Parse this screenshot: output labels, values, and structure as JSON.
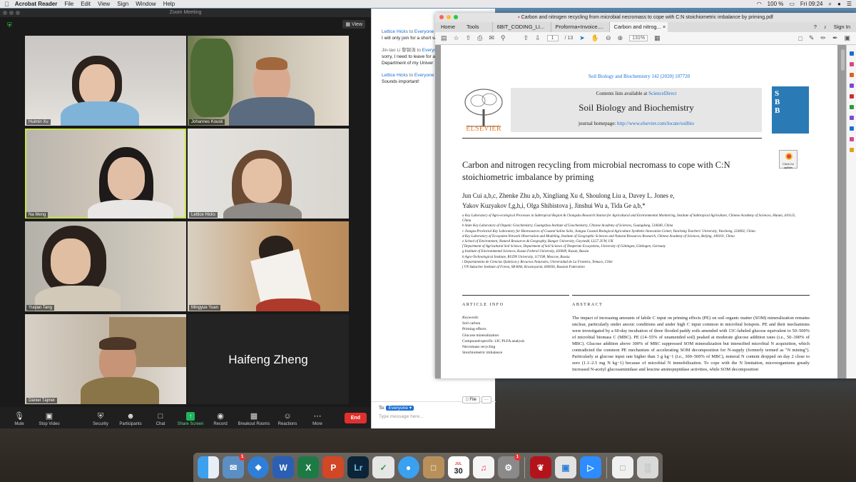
{
  "menubar": {
    "app": "Acrobat Reader",
    "menus": [
      "File",
      "Edit",
      "View",
      "Sign",
      "Window",
      "Help"
    ],
    "battery": "100 %",
    "clock": "Fri 09:24"
  },
  "zoom": {
    "window_title": "Zoom Meeting",
    "view_label": "View",
    "participants": [
      "Huimin Xu",
      "Johannes Kousk",
      "Na Meng",
      "Lettice Hicks",
      "Yuqian Tang",
      "Mingyue Yuan",
      "Dániel Tájmel",
      "Haifeng Zheng"
    ],
    "toolbar": {
      "mute": "Mute",
      "stop_video": "Stop Video",
      "security": "Security",
      "participants": "Participants",
      "chat": "Chat",
      "share": "Share Screen",
      "record": "Record",
      "breakout": "Breakout Rooms",
      "reactions": "Reactions",
      "more": "More",
      "end": "End"
    }
  },
  "chat": {
    "messages": [
      {
        "from": "Lettice Hicks",
        "to": "Everyone",
        "text": "I will only join for a short w"
      },
      {
        "from": "Jin-tao Li 黎锦涛",
        "to": "Everyo",
        "text": "sorry, I need to leave for a an emergency meeting wi Department of my Univer"
      },
      {
        "from": "Lettice Hicks",
        "to": "Everyone",
        "text": "Sounds important!"
      }
    ],
    "to_word": "to",
    "to_label": "To:",
    "to_value": "Everyone ▾",
    "placeholder": "Type message here...",
    "file_label": "File",
    "more_label": "···"
  },
  "acrobat": {
    "window_title": "Carbon and nitrogen recycling from microbial necromass to cope with C:N stoichiometric imbalance by priming.pdf",
    "nav": {
      "home": "Home",
      "tools": "Tools",
      "signin": "Sign In"
    },
    "tabs": [
      "6BIT_CODING_LI...",
      "Proforma+Invoice....",
      "Carbon and nitrog... ×"
    ],
    "page_current": "1",
    "page_total": "/ 13",
    "zoom": "131%",
    "paper": {
      "journal_ref": "Soil Biology and Biochemistry 142 (2020) 107720",
      "contents_prefix": "Contents lists available at",
      "contents_link": "ScienceDirect",
      "journal_name": "Soil Biology and Biochemistry",
      "homepage_prefix": "journal homepage:",
      "homepage_url": "http://www.elsevier.com/locate/soilbio",
      "publisher": "ELSEVIER",
      "badge": "Check for updates",
      "title": "Carbon and nitrogen recycling from microbial necromass to cope with C:N stoichiometric imbalance by priming",
      "authors_line1": "Jun Cui a,b,c, Zhenke Zhu a,b, Xingliang Xu d, Shoulong Liu a, Davey L. Jones e,",
      "authors_line2": "Yakov Kuzyakov f,g,h,i, Olga Shibistova j, Jinshui Wu a, Tida Ge a,b,*",
      "affiliations": [
        "a Key Laboratory of Agro-ecological Processes in Subtropical Region & Changsha Research Station for Agricultural and Environmental Monitoring, Institute of Subtropical Agriculture, Chinese Academy of Sciences, Hunan, 410125, China",
        "b State Key Laboratory of Organic Geochemistry, Guangzhou Institute of Geochemistry, Chinese Academy of Sciences, Guangdong, 510640, China",
        "c Jiangsu Provincial Key Laboratory for Bioresources of Coastal Saline Soils, Jiangsu Coastal Biological Agriculture Synthetic Innovation Center, Yancheng Teachers' University, Yancheng, 224002, China",
        "d Key Laboratory of Ecosystem Network Observation and Modeling, Institute of Geographic Sciences and Natural Resources Research, Chinese Academy of Sciences, Beijing, 100101, China",
        "e School of Environment, Natural Resources & Geography, Bangor University, Gwynedd, LL57 2UW, UK",
        "f Department of Agricultural Soil Science, Department of Soil Science of Temperate Ecosystems, University of Göttingen, Göttingen, Germany",
        "g Institute of Environmental Sciences, Kazan Federal University, 420049, Kazan, Russia",
        "h Agro-Technological Institute, RUDN University, 117198, Moscow, Russia",
        "i Departamento de Ciencias Químicas y Recursos Naturales, Universidad de La Frontera, Temuco, Chile",
        "j VN Sukachev Institute of Forest, SB-RAS, Krasnoyarsk, 660036, Russian Federation"
      ],
      "article_info_heading": "ARTICLE INFO",
      "keywords_label": "Keywords:",
      "keywords": [
        "Soil carbon",
        "Priming effects",
        "Glucose mineralization",
        "Compound-specific 13C PLFA analysis",
        "Necromass recycling",
        "Stoichiometric imbalance"
      ],
      "abstract_heading": "ABSTRACT",
      "abstract": "The impact of increasing amounts of labile C input on priming effects (PE) on soil organic matter (SOM) mineralization remains unclear, particularly under anoxic conditions and under high C input common in microbial hotspots. PE and their mechanisms were investigated by a 60-day incubation of three flooded paddy soils amended with 13C-labeled glucose equivalent to 50–500% of microbial biomass C (MBC). PE (14–55% of unamended soil) peaked at moderate glucose addition rates (i.e., 50–300% of MBC). Glucose addition above 300% of MBC suppressed SOM mineralization but intensified microbial N acquisition, which contradicted the common PE mechanism of accelerating SOM decomposition for N-supply (formerly termed as \"N mining\"). Particularly at glucose input rate higher than 3 g kg−1 (i.e., 300–500% of MBC), mineral N content dropped on day 2 close to zero (1.1–2.5 mg N kg−1) because of microbial N immobilization. To cope with the N limitation, microorganisms greatly increased N-acetyl glucosaminidase and leucine aminopeptidase activities, while SOM decomposition"
    }
  },
  "dock": {
    "calendar_month": "JUL",
    "calendar_day": "30",
    "mail_badge": "1",
    "prefs_badge": "1"
  },
  "colors": {
    "zoom_active": "#c7e54b",
    "share_green": "#1db65b",
    "end_red": "#e0302e",
    "link_blue": "#1a6fd1",
    "elsevier_orange": "#f07a20"
  }
}
